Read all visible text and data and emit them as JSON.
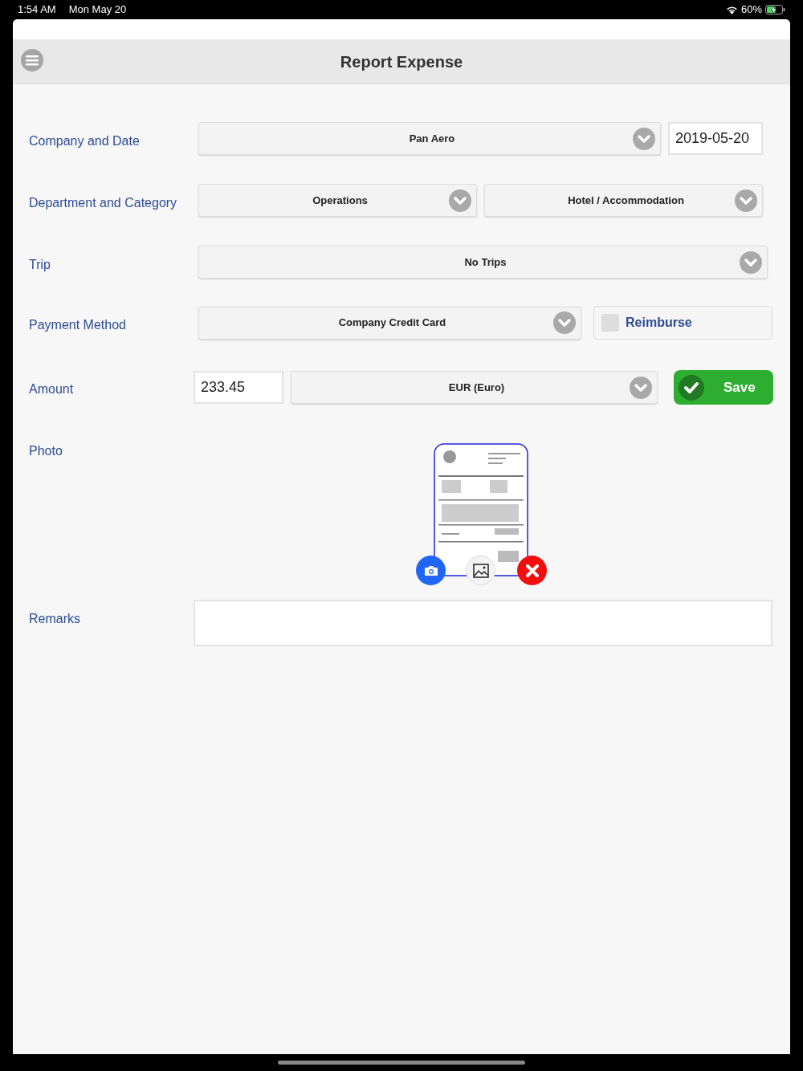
{
  "status_bar": {
    "time": "1:54 AM",
    "date": "Mon May 20",
    "battery": "60%",
    "charging": true
  },
  "header": {
    "title": "Report Expense"
  },
  "rows": [
    {
      "label": "Company and Date",
      "controls": [
        {
          "kind": "select",
          "value": "Pan Aero"
        },
        {
          "kind": "input",
          "value": "2019-05-20"
        }
      ]
    },
    {
      "label": "Department and Category",
      "controls": [
        {
          "kind": "select",
          "value": "Operations"
        },
        {
          "kind": "select",
          "value": "Hotel / Accommodation"
        }
      ]
    },
    {
      "label": "Trip",
      "controls": [
        {
          "kind": "select",
          "value": "No Trips"
        }
      ]
    },
    {
      "label": "Payment Method",
      "controls": [
        {
          "kind": "select",
          "value": "Company Credit Card"
        },
        {
          "kind": "checkbox",
          "label": "Reimburse",
          "checked": false
        }
      ]
    },
    {
      "label": "Amount",
      "controls": [
        {
          "kind": "input",
          "value": "233.45"
        },
        {
          "kind": "select",
          "value": "EUR (Euro)"
        },
        {
          "kind": "button",
          "label": "Save"
        }
      ]
    },
    {
      "label": "Photo"
    },
    {
      "label": "Remarks",
      "controls": [
        {
          "kind": "textarea"
        }
      ]
    }
  ]
}
